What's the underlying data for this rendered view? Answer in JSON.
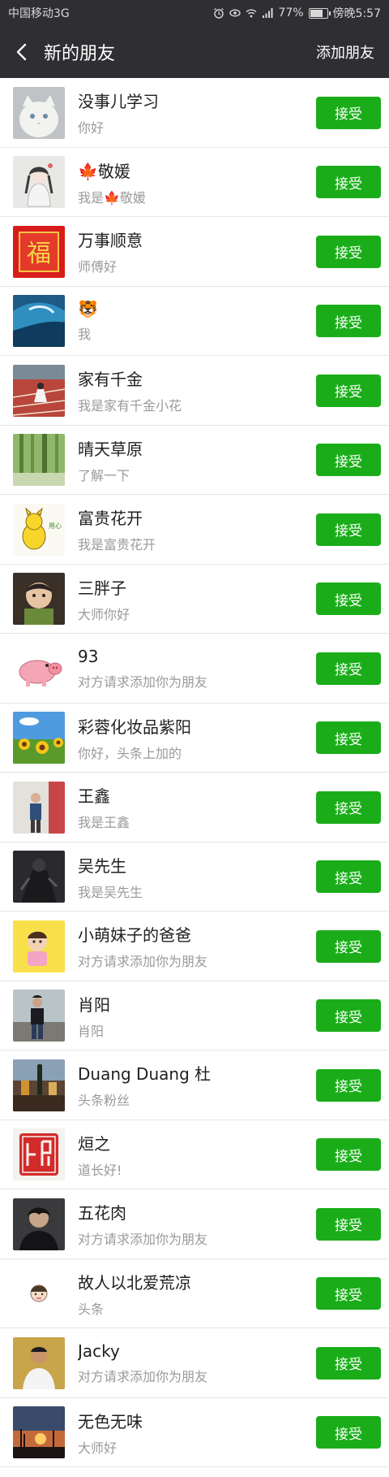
{
  "status_bar": {
    "carrier": "中国移动3G",
    "battery_percent": "77%",
    "battery_level": 0.77,
    "time": "傍晚5:57",
    "icons": [
      "alarm-icon",
      "eye-icon",
      "wifi-icon",
      "signal-icon",
      "battery-icon"
    ]
  },
  "nav": {
    "back_icon": "chevron-left-icon",
    "title": "新的朋友",
    "action": "添加朋友"
  },
  "accept_label": "接受",
  "accent_color": "#1aad19",
  "friends": [
    {
      "name": "没事儿学习",
      "message": "你好",
      "avatar": "white-cat-photo"
    },
    {
      "name": "🍁敬媛",
      "message": "我是🍁敬媛",
      "avatar": "anime-girl-drawing"
    },
    {
      "name": "万事顺意",
      "message": "师傅好",
      "avatar": "red-fu-character"
    },
    {
      "name": "🐯",
      "message": "我",
      "avatar": "ocean-wave"
    },
    {
      "name": "家有千金",
      "message": "我是家有千金小花",
      "avatar": "running-track"
    },
    {
      "name": "晴天草原",
      "message": "了解一下",
      "avatar": "bamboo-forest"
    },
    {
      "name": "富贵花开",
      "message": "我是富贵花开",
      "avatar": "yellow-cartoon-cat"
    },
    {
      "name": "三胖子",
      "message": "大师你好",
      "avatar": "baby-photo"
    },
    {
      "name": "93",
      "message": "对方请求添加你为朋友",
      "avatar": "pink-pig-cartoon"
    },
    {
      "name": "彩蓉化妆品紫阳",
      "message": "你好，头条上加的",
      "avatar": "sunflower-field"
    },
    {
      "name": "王鑫",
      "message": "我是王鑫",
      "avatar": "man-standing-photo"
    },
    {
      "name": "吴先生",
      "message": "我是吴先生",
      "avatar": "dark-figure-photo"
    },
    {
      "name": "小萌妹子的爸爸",
      "message": "对方请求添加你为朋友",
      "avatar": "toddler-yellow"
    },
    {
      "name": "肖阳",
      "message": "肖阳",
      "avatar": "man-outdoor-photo"
    },
    {
      "name": "Duang Duang 杜",
      "message": "头条粉丝",
      "avatar": "drinks-table"
    },
    {
      "name": "烜之",
      "message": "道长好!",
      "avatar": "red-seal-stamp"
    },
    {
      "name": "五花肉",
      "message": "对方请求添加你为朋友",
      "avatar": "man-dark-jacket"
    },
    {
      "name": "故人以北爱荒凉",
      "message": "头条",
      "avatar": "small-cartoon-face"
    },
    {
      "name": "Jacky",
      "message": "对方请求添加你为朋友",
      "avatar": "man-white-shirt"
    },
    {
      "name": "无色无味",
      "message": "大师好",
      "avatar": "sunset-silhouette"
    }
  ]
}
